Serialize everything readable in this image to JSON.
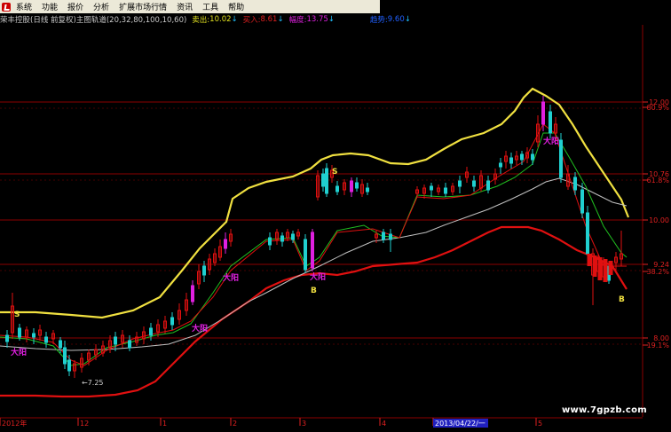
{
  "menu": {
    "items": [
      "系统",
      "功能",
      "报价",
      "分析",
      "扩展市场行情",
      "资讯",
      "工具",
      "帮助"
    ]
  },
  "indicator_bar": {
    "title": "荣丰控股(日线 前复权)",
    "indicator": "主图轨道(20,32,80,100,10,60)",
    "sell_label": "卖出:",
    "sell_value": "10.02",
    "sell_arrow": "↓",
    "buy_label": "买入:",
    "buy_value": "8.61",
    "buy_arrow": "↓",
    "amp_label": "幅度:",
    "amp_value": "13.75",
    "amp_arrow": "↓",
    "tail_label": "趋势:",
    "tail_value": "9.60",
    "tail_arrow": "↓"
  },
  "price_axis": {
    "labels": [
      "12.00",
      "80.9%",
      "10.76",
      "61.8%",
      "10.00",
      "9.24",
      "38.2%",
      "8.00",
      "19.1%"
    ],
    "grid_prices": [
      12.0,
      10.76,
      10.0,
      9.24,
      8.0
    ]
  },
  "time_axis": {
    "labels": [
      "2012年",
      "12",
      "1",
      "2",
      "3",
      "4",
      "2013/04/22/一",
      "5"
    ]
  },
  "signals": {
    "low_marker": "←7.25",
    "buy_label": "B",
    "sell_label": "S",
    "big_yang": "大阳"
  },
  "colors": {
    "upper_band": "#f0e040",
    "lower_band": "#e01010",
    "middle_line": "#c0c0c0",
    "ma_green": "#20c020",
    "candle_up": "#e01010",
    "candle_down": "#20d0d0",
    "magenta": "#e020e0",
    "grid": "#8b0000"
  },
  "watermark": "www.7gpzb.com",
  "chart_data": {
    "type": "line",
    "title": "荣丰控股(日线 前复权)",
    "series": [
      {
        "name": "卖出",
        "values": [
          10.02
        ]
      },
      {
        "name": "买入",
        "values": [
          8.61
        ]
      }
    ],
    "ylim": [
      7.0,
      12.2
    ]
  }
}
